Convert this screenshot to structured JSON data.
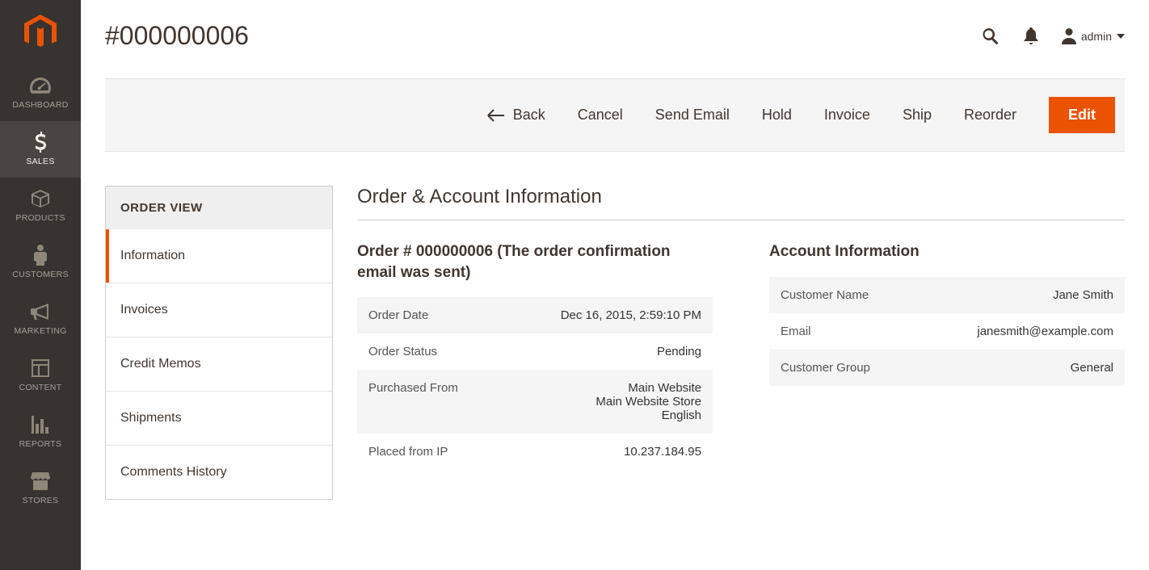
{
  "colors": {
    "accent": "#eb5202"
  },
  "nav": {
    "items": [
      {
        "id": "dashboard",
        "label": "DASHBOARD"
      },
      {
        "id": "sales",
        "label": "SALES"
      },
      {
        "id": "products",
        "label": "PRODUCTS"
      },
      {
        "id": "customers",
        "label": "CUSTOMERS"
      },
      {
        "id": "marketing",
        "label": "MARKETING"
      },
      {
        "id": "content",
        "label": "CONTENT"
      },
      {
        "id": "reports",
        "label": "REPORTS"
      },
      {
        "id": "stores",
        "label": "STORES"
      }
    ],
    "activeId": "sales"
  },
  "header": {
    "title": "#000000006",
    "user_label": "admin"
  },
  "actions": {
    "back": "Back",
    "cancel": "Cancel",
    "send_email": "Send Email",
    "hold": "Hold",
    "invoice": "Invoice",
    "ship": "Ship",
    "reorder": "Reorder",
    "edit": "Edit"
  },
  "order_view": {
    "panel_title": "ORDER VIEW",
    "tabs": [
      {
        "id": "information",
        "label": "Information"
      },
      {
        "id": "invoices",
        "label": "Invoices"
      },
      {
        "id": "credit_memos",
        "label": "Credit Memos"
      },
      {
        "id": "shipments",
        "label": "Shipments"
      },
      {
        "id": "comments_history",
        "label": "Comments History"
      }
    ],
    "active_tab": "information"
  },
  "section": {
    "title": "Order & Account Information",
    "order_heading": "Order # 000000006 (The order confirmation email was sent)",
    "account_heading": "Account Information",
    "order_rows": [
      {
        "k": "Order Date",
        "v": "Dec 16, 2015, 2:59:10 PM"
      },
      {
        "k": "Order Status",
        "v": "Pending"
      },
      {
        "k": "Purchased From",
        "v": "Main Website\nMain Website Store\nEnglish"
      },
      {
        "k": "Placed from IP",
        "v": "10.237.184.95"
      }
    ],
    "account_rows": [
      {
        "k": "Customer Name",
        "v": "Jane Smith",
        "link": true
      },
      {
        "k": "Email",
        "v": "janesmith@example.com",
        "link": true
      },
      {
        "k": "Customer Group",
        "v": "General",
        "link": false
      }
    ]
  }
}
